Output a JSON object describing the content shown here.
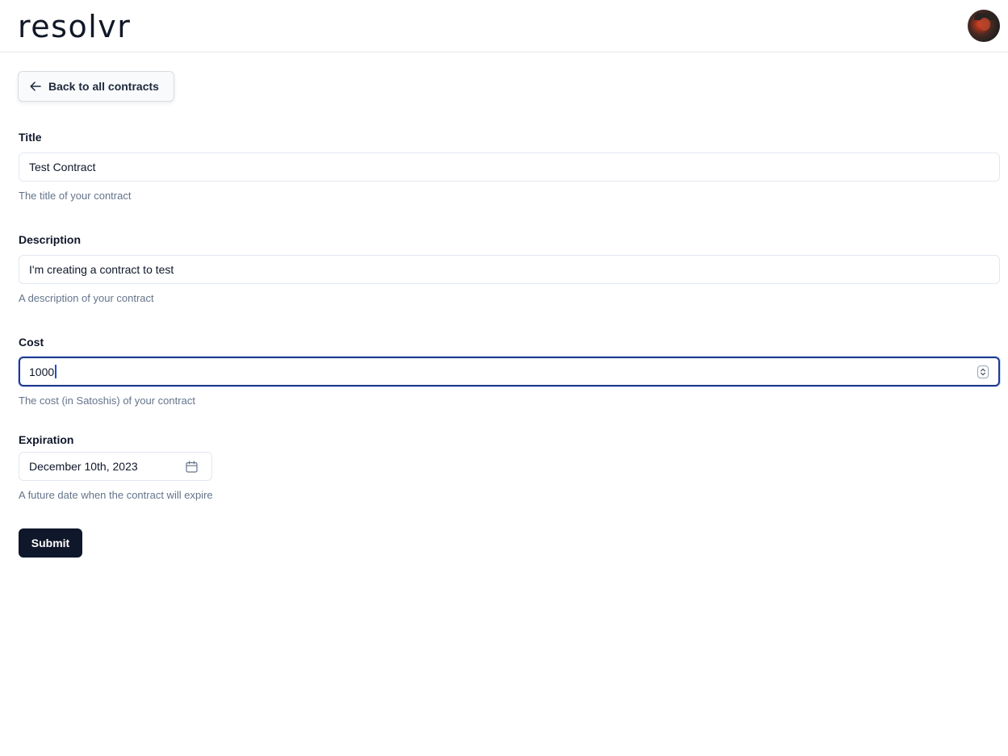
{
  "header": {
    "logo_text": "resolvr"
  },
  "nav": {
    "back_label": "Back to all contracts"
  },
  "form": {
    "title": {
      "label": "Title",
      "value": "Test Contract",
      "help": "The title of your contract"
    },
    "description": {
      "label": "Description",
      "value": "I'm creating a contract to test",
      "help": "A description of your contract"
    },
    "cost": {
      "label": "Cost",
      "value": "1000",
      "help": "The cost (in Satoshis) of your contract"
    },
    "expiration": {
      "label": "Expiration",
      "value": "December 10th, 2023",
      "help": "A future date when the contract will expire"
    },
    "submit_label": "Submit"
  },
  "colors": {
    "primary": "#0f172a",
    "focus_ring": "#1e3a8a",
    "muted_text": "#64748b",
    "border": "#e2e8f0"
  }
}
